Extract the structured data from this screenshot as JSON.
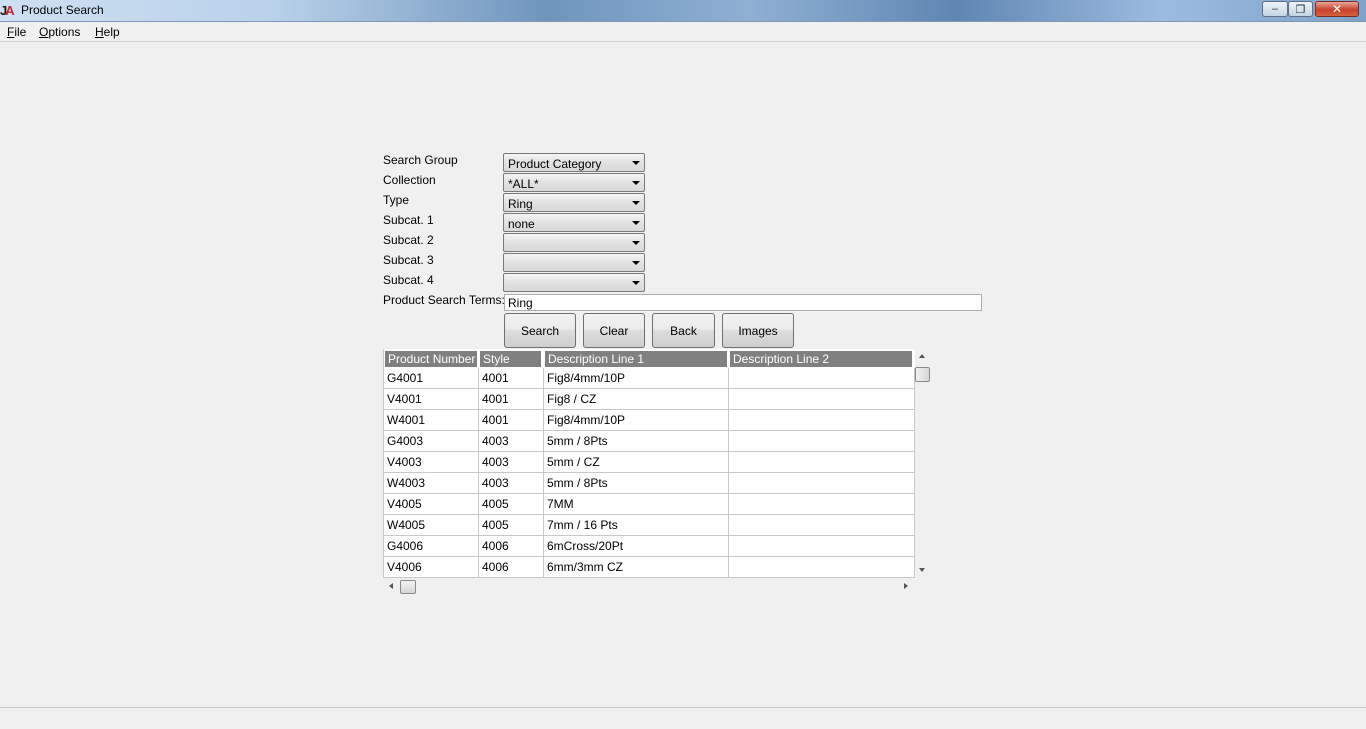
{
  "window": {
    "title": "Product Search"
  },
  "menu": {
    "file": {
      "accel": "F",
      "rest": "ile"
    },
    "options": {
      "accel": "O",
      "rest": "ptions"
    },
    "help": {
      "accel": "H",
      "rest": "elp"
    }
  },
  "form": {
    "search_group": {
      "label": "Search Group",
      "value": "Product Category"
    },
    "collection": {
      "label": "Collection",
      "value": "*ALL*"
    },
    "type": {
      "label": "Type",
      "value": "Ring"
    },
    "subcat1": {
      "label": "Subcat. 1",
      "value": "none"
    },
    "subcat2": {
      "label": "Subcat. 2",
      "value": ""
    },
    "subcat3": {
      "label": "Subcat. 3",
      "value": ""
    },
    "subcat4": {
      "label": "Subcat. 4",
      "value": ""
    },
    "search_terms": {
      "label": "Product Search Terms:",
      "value": "Ring"
    }
  },
  "buttons": {
    "search": "Search",
    "clear": "Clear",
    "back": "Back",
    "images": "Images"
  },
  "grid": {
    "columns": [
      "Product Number",
      "Style",
      "Description Line 1",
      "Description Line 2"
    ],
    "rows": [
      [
        "G4001",
        "4001",
        "Fig8/4mm/10P",
        ""
      ],
      [
        "V4001",
        "4001",
        "Fig8 / CZ",
        ""
      ],
      [
        "W4001",
        "4001",
        "Fig8/4mm/10P",
        ""
      ],
      [
        "G4003",
        "4003",
        "5mm / 8Pts",
        ""
      ],
      [
        "V4003",
        "4003",
        "5mm / CZ",
        ""
      ],
      [
        "W4003",
        "4003",
        "5mm / 8Pts",
        ""
      ],
      [
        "V4005",
        "4005",
        "7MM",
        ""
      ],
      [
        "W4005",
        "4005",
        "7mm / 16 Pts",
        ""
      ],
      [
        "G4006",
        "4006",
        "6mCross/20Pt",
        ""
      ],
      [
        "V4006",
        "4006",
        "6mm/3mm CZ",
        ""
      ]
    ]
  },
  "icons": {
    "app": "app-logo-icon",
    "minimize": "minimize-icon",
    "maximize": "restore-icon",
    "close": "close-icon"
  }
}
